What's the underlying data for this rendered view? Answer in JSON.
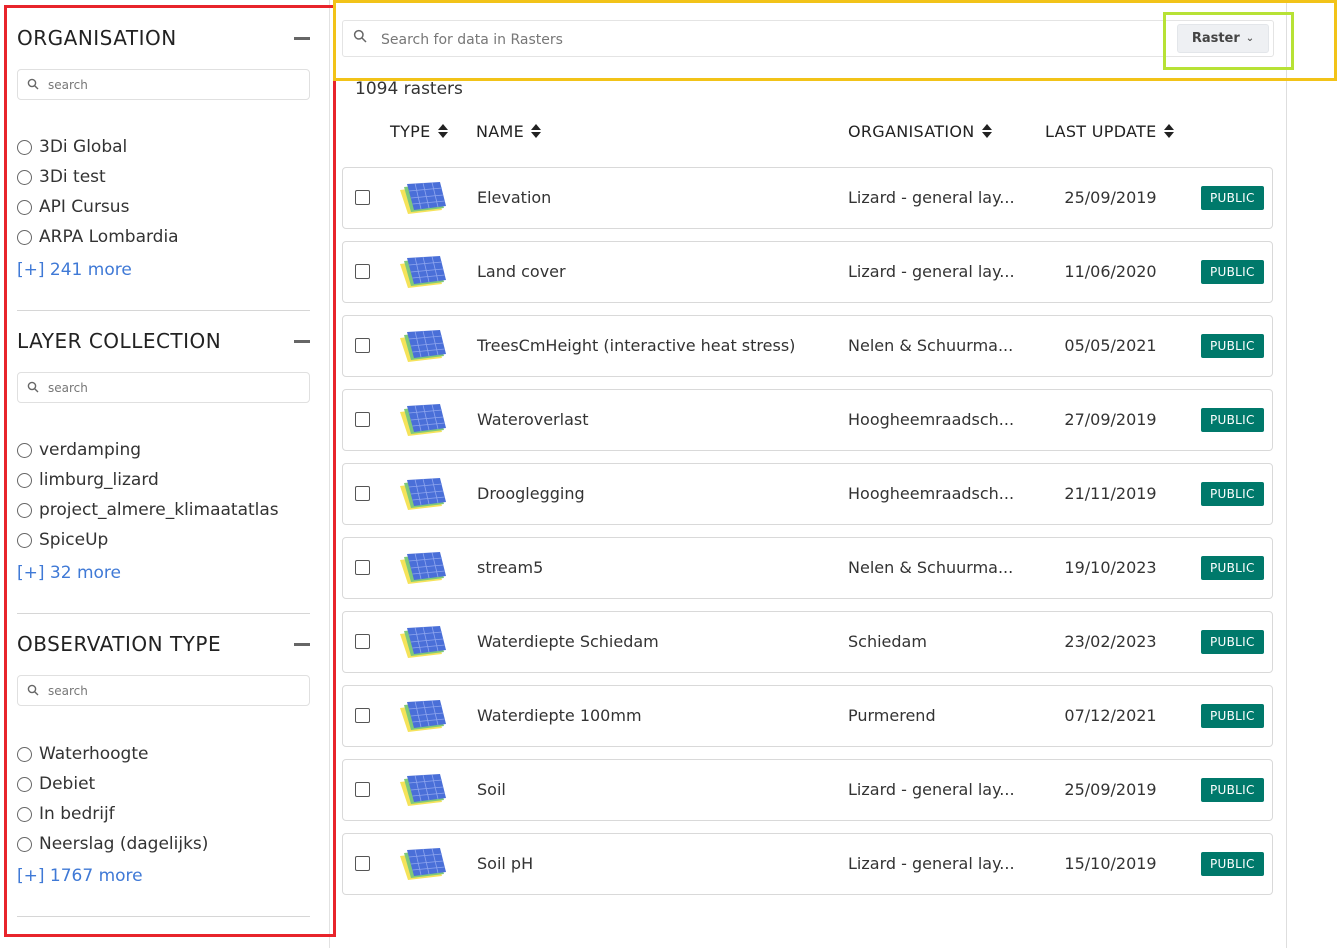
{
  "sidebar": {
    "facets": [
      {
        "title": "ORGANISATION",
        "search_placeholder": "search",
        "options": [
          "3Di Global",
          "3Di test",
          "API Cursus",
          "ARPA Lombardia"
        ],
        "more": "[+] 241 more"
      },
      {
        "title": "LAYER COLLECTION",
        "search_placeholder": "search",
        "options": [
          "verdamping",
          "limburg_lizard",
          "project_almere_klimaatatlas",
          "SpiceUp"
        ],
        "more": "[+] 32 more"
      },
      {
        "title": "OBSERVATION TYPE",
        "search_placeholder": "search",
        "options": [
          "Waterhoogte",
          "Debiet",
          "In bedrijf",
          "Neerslag (dagelijks)"
        ],
        "more": "[+] 1767 more"
      }
    ]
  },
  "search": {
    "placeholder": "Search for data in Rasters",
    "type_label": "Raster"
  },
  "results": {
    "count_label": "1094 rasters",
    "columns": {
      "type": "TYPE",
      "name": "NAME",
      "organisation": "ORGANISATION",
      "last_update": "LAST UPDATE"
    },
    "rows": [
      {
        "name": "Elevation",
        "organisation": "Lizard - general lay...",
        "last_update": "25/09/2019",
        "access": "PUBLIC"
      },
      {
        "name": "Land cover",
        "organisation": "Lizard - general lay...",
        "last_update": "11/06/2020",
        "access": "PUBLIC"
      },
      {
        "name": "TreesCmHeight (interactive heat stress)",
        "organisation": "Nelen & Schuurma...",
        "last_update": "05/05/2021",
        "access": "PUBLIC"
      },
      {
        "name": "Wateroverlast",
        "organisation": "Hoogheemraadsch...",
        "last_update": "27/09/2019",
        "access": "PUBLIC"
      },
      {
        "name": "Drooglegging",
        "organisation": "Hoogheemraadsch...",
        "last_update": "21/11/2019",
        "access": "PUBLIC"
      },
      {
        "name": "stream5",
        "organisation": "Nelen & Schuurma...",
        "last_update": "19/10/2023",
        "access": "PUBLIC"
      },
      {
        "name": "Waterdiepte Schiedam",
        "organisation": "Schiedam",
        "last_update": "23/02/2023",
        "access": "PUBLIC"
      },
      {
        "name": "Waterdiepte 100mm",
        "organisation": "Purmerend",
        "last_update": "07/12/2021",
        "access": "PUBLIC"
      },
      {
        "name": "Soil",
        "organisation": "Lizard - general lay...",
        "last_update": "25/09/2019",
        "access": "PUBLIC"
      },
      {
        "name": "Soil pH",
        "organisation": "Lizard - general lay...",
        "last_update": "15/10/2019",
        "access": "PUBLIC"
      }
    ]
  },
  "icons": {
    "raster": "raster-layers-icon",
    "search": "search-icon",
    "collapse": "minus-icon",
    "dropdown": "chevron-down-icon"
  },
  "colors": {
    "link": "#3f79d6",
    "badge": "#00796b",
    "sidebar_outline": "#e8242b",
    "searchbar_outline": "#f2c318",
    "dropdown_outline": "#b7e235"
  }
}
